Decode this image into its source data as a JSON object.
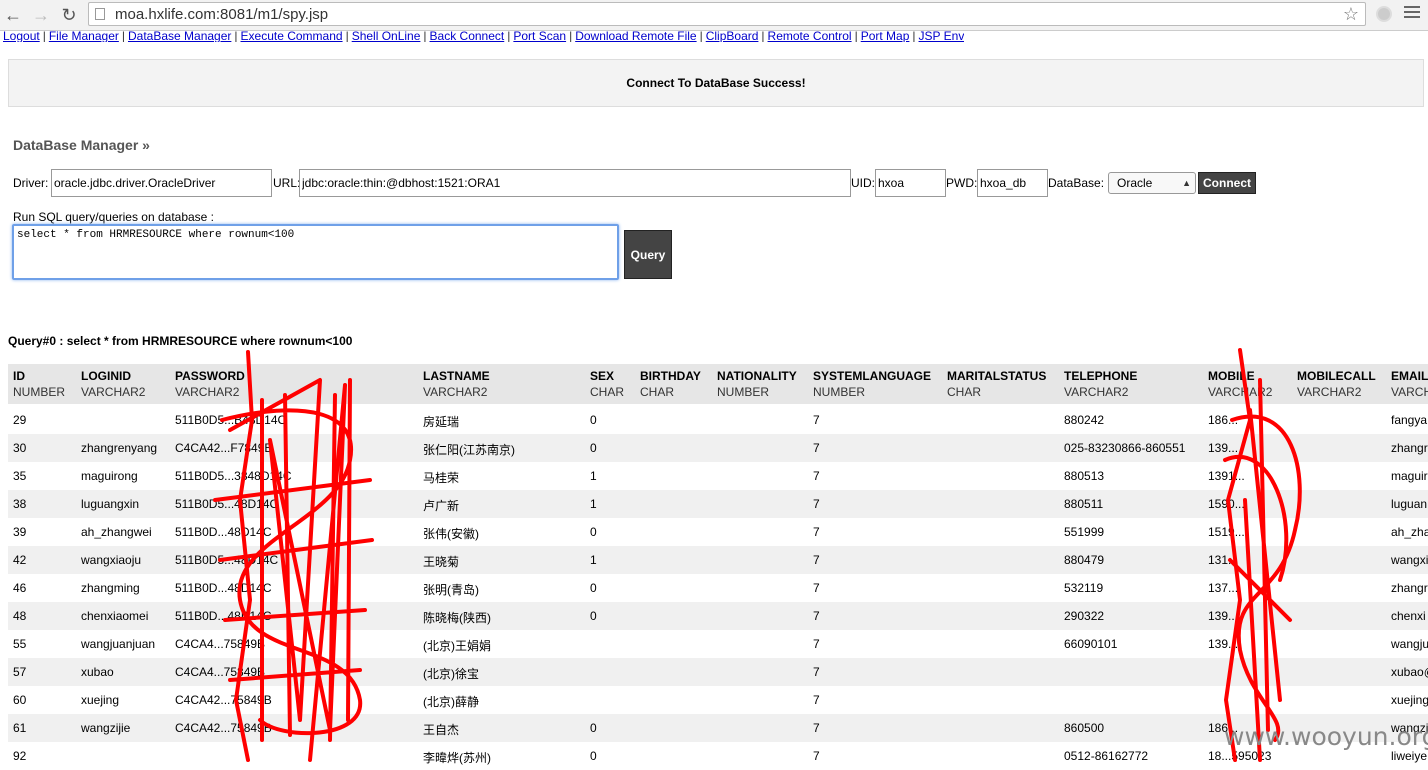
{
  "browser": {
    "url": "moa.hxlife.com:8081/m1/spy.jsp"
  },
  "nav_links": [
    "Logout",
    "File Manager",
    "DataBase Manager",
    "Execute Command",
    "Shell OnLine",
    "Back Connect",
    "Port Scan",
    "Download Remote File",
    "ClipBoard",
    "Remote Control",
    "Port Map",
    "JSP Env"
  ],
  "message": "Connect To DataBase Success!",
  "db_manager": {
    "title": "DataBase Manager »",
    "driver_label": "Driver:",
    "driver_value": "oracle.jdbc.driver.OracleDriver",
    "url_label": "URL:",
    "url_value": "jdbc:oracle:thin:@dbhost:1521:ORA1",
    "uid_label": "UID:",
    "uid_value": "hxoa",
    "pwd_label": "PWD:",
    "pwd_value": "hxoa_db",
    "db_label": "DataBase:",
    "db_selected": "Oracle",
    "connect_label": "Connect",
    "sql_label": "Run SQL query/queries on database :",
    "sql_value": "select * from HRMRESOURCE where rownum<100",
    "query_label": "Query"
  },
  "result": {
    "title": "Query#0 : select * from HRMRESOURCE where rownum<100",
    "columns": [
      {
        "name": "ID",
        "type": "NUMBER"
      },
      {
        "name": "LOGINID",
        "type": "VARCHAR2"
      },
      {
        "name": "PASSWORD",
        "type": "VARCHAR2"
      },
      {
        "name": "LASTNAME",
        "type": "VARCHAR2"
      },
      {
        "name": "SEX",
        "type": "CHAR"
      },
      {
        "name": "BIRTHDAY",
        "type": "CHAR"
      },
      {
        "name": "NATIONALITY",
        "type": "NUMBER"
      },
      {
        "name": "SYSTEMLANGUAGE",
        "type": "NUMBER"
      },
      {
        "name": "MARITALSTATUS",
        "type": "CHAR"
      },
      {
        "name": "TELEPHONE",
        "type": "VARCHAR2"
      },
      {
        "name": "MOBILE",
        "type": "VARCHAR2"
      },
      {
        "name": "MOBILECALL",
        "type": "VARCHAR2"
      },
      {
        "name": "EMAIL",
        "type": "VARCH"
      }
    ],
    "rows": [
      [
        "29",
        "",
        "511B0D5...B48D14C",
        "房延瑞",
        "0",
        "",
        "",
        "7",
        "",
        "880242",
        "186...",
        "",
        "fangya"
      ],
      [
        "30",
        "zhangrenyang",
        "C4CA42...F7849B",
        "张仁阳(江苏南京)",
        "0",
        "",
        "",
        "7",
        "",
        "025-83230866-860551",
        "139...",
        "",
        "zhangr"
      ],
      [
        "35",
        "maguirong",
        "511B0D5...3848D14C",
        "马桂荣",
        "1",
        "",
        "",
        "7",
        "",
        "880513",
        "1391...",
        "",
        "maguir"
      ],
      [
        "38",
        "luguangxin",
        "511B0D5...48D14C",
        "卢广新",
        "1",
        "",
        "",
        "7",
        "",
        "880511",
        "1590...",
        "",
        "luguan"
      ],
      [
        "39",
        "ah_zhangwei",
        "511B0D...48D14C",
        "张伟(安徽)",
        "0",
        "",
        "",
        "7",
        "",
        "551999",
        "1519...",
        "",
        "ah_zha"
      ],
      [
        "42",
        "wangxiaoju",
        "511B0D5...48D14C",
        "王晓菊",
        "1",
        "",
        "",
        "7",
        "",
        "880479",
        "131...",
        "",
        "wangxi"
      ],
      [
        "46",
        "zhangming",
        "511B0D...48D14C",
        "张明(青岛)",
        "0",
        "",
        "",
        "7",
        "",
        "532119",
        "137...",
        "",
        "zhangr"
      ],
      [
        "48",
        "chenxiaomei",
        "511B0D...48D14C",
        "陈晓梅(陕西)",
        "0",
        "",
        "",
        "7",
        "",
        "290322",
        "139...",
        "",
        "chenxi"
      ],
      [
        "55",
        "wangjuanjuan",
        "C4CA4...75849B",
        "(北京)王娟娟",
        "",
        "",
        "",
        "7",
        "",
        "66090101",
        "139...",
        "",
        "wangju"
      ],
      [
        "57",
        "xubao",
        "C4CA4...75849B",
        "(北京)徐宝",
        "",
        "",
        "",
        "7",
        "",
        "",
        "",
        "",
        "xubao@"
      ],
      [
        "60",
        "xuejing",
        "C4CA42...75849B",
        "(北京)薛静",
        "",
        "",
        "",
        "7",
        "",
        "",
        "",
        "",
        "xuejing"
      ],
      [
        "61",
        "wangzijie",
        "C4CA42...75849B",
        "王自杰",
        "0",
        "",
        "",
        "7",
        "",
        "860500",
        "186...",
        "",
        "wangzi"
      ],
      [
        "92",
        "",
        "",
        "李暐烨(苏州)",
        "0",
        "",
        "",
        "7",
        "",
        "0512-86162772",
        "18...595023",
        "",
        "liweiye"
      ]
    ]
  },
  "watermark": "www.wooyun.org",
  "colors": {
    "scribble": "#ff0000",
    "button_bg": "#444444",
    "link": "#0000cc"
  }
}
